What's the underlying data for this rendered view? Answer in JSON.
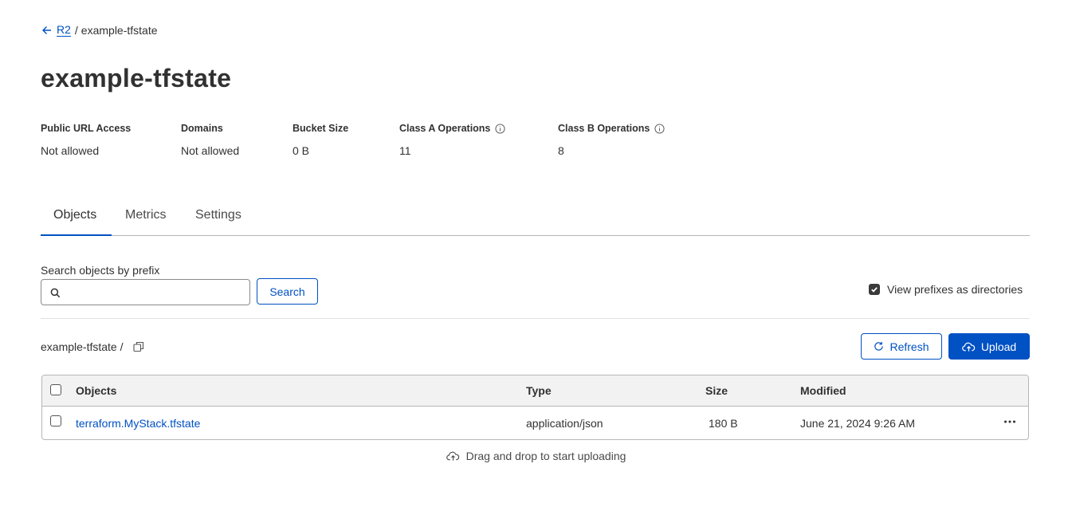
{
  "breadcrumb": {
    "parent": "R2",
    "separator": "/",
    "current": "example-tfstate"
  },
  "title": "example-tfstate",
  "stats": [
    {
      "label": "Public URL Access",
      "value": "Not allowed"
    },
    {
      "label": "Domains",
      "value": "Not allowed"
    },
    {
      "label": "Bucket Size",
      "value": "0 B"
    },
    {
      "label": "Class A Operations",
      "value": "11"
    },
    {
      "label": "Class B Operations",
      "value": "8"
    }
  ],
  "tabs": [
    {
      "label": "Objects",
      "active": true
    },
    {
      "label": "Metrics",
      "active": false
    },
    {
      "label": "Settings",
      "active": false
    }
  ],
  "search": {
    "label": "Search objects by prefix",
    "placeholder": "",
    "value": "",
    "button": "Search"
  },
  "view_prefixes": {
    "label": "View prefixes as directories",
    "checked": true
  },
  "path": {
    "text": "example-tfstate /"
  },
  "actions": {
    "refresh": "Refresh",
    "upload": "Upload"
  },
  "table": {
    "columns": [
      "Objects",
      "Type",
      "Size",
      "Modified"
    ],
    "rows": [
      {
        "name": "terraform.MyStack.tfstate",
        "type": "application/json",
        "size": "180 B",
        "modified": "June 21, 2024 9:26 AM"
      }
    ]
  },
  "dropzone": "Drag and drop to start uploading",
  "colors": {
    "accent": "#0051c3",
    "text": "#313131",
    "border": "#b6b6b6",
    "header_bg": "#f2f2f2"
  },
  "icons": [
    "arrow-left-icon",
    "info-icon",
    "search-icon",
    "checkbox-checked-icon",
    "copy-icon",
    "refresh-icon",
    "upload-cloud-icon",
    "more-horizontal-icon"
  ]
}
